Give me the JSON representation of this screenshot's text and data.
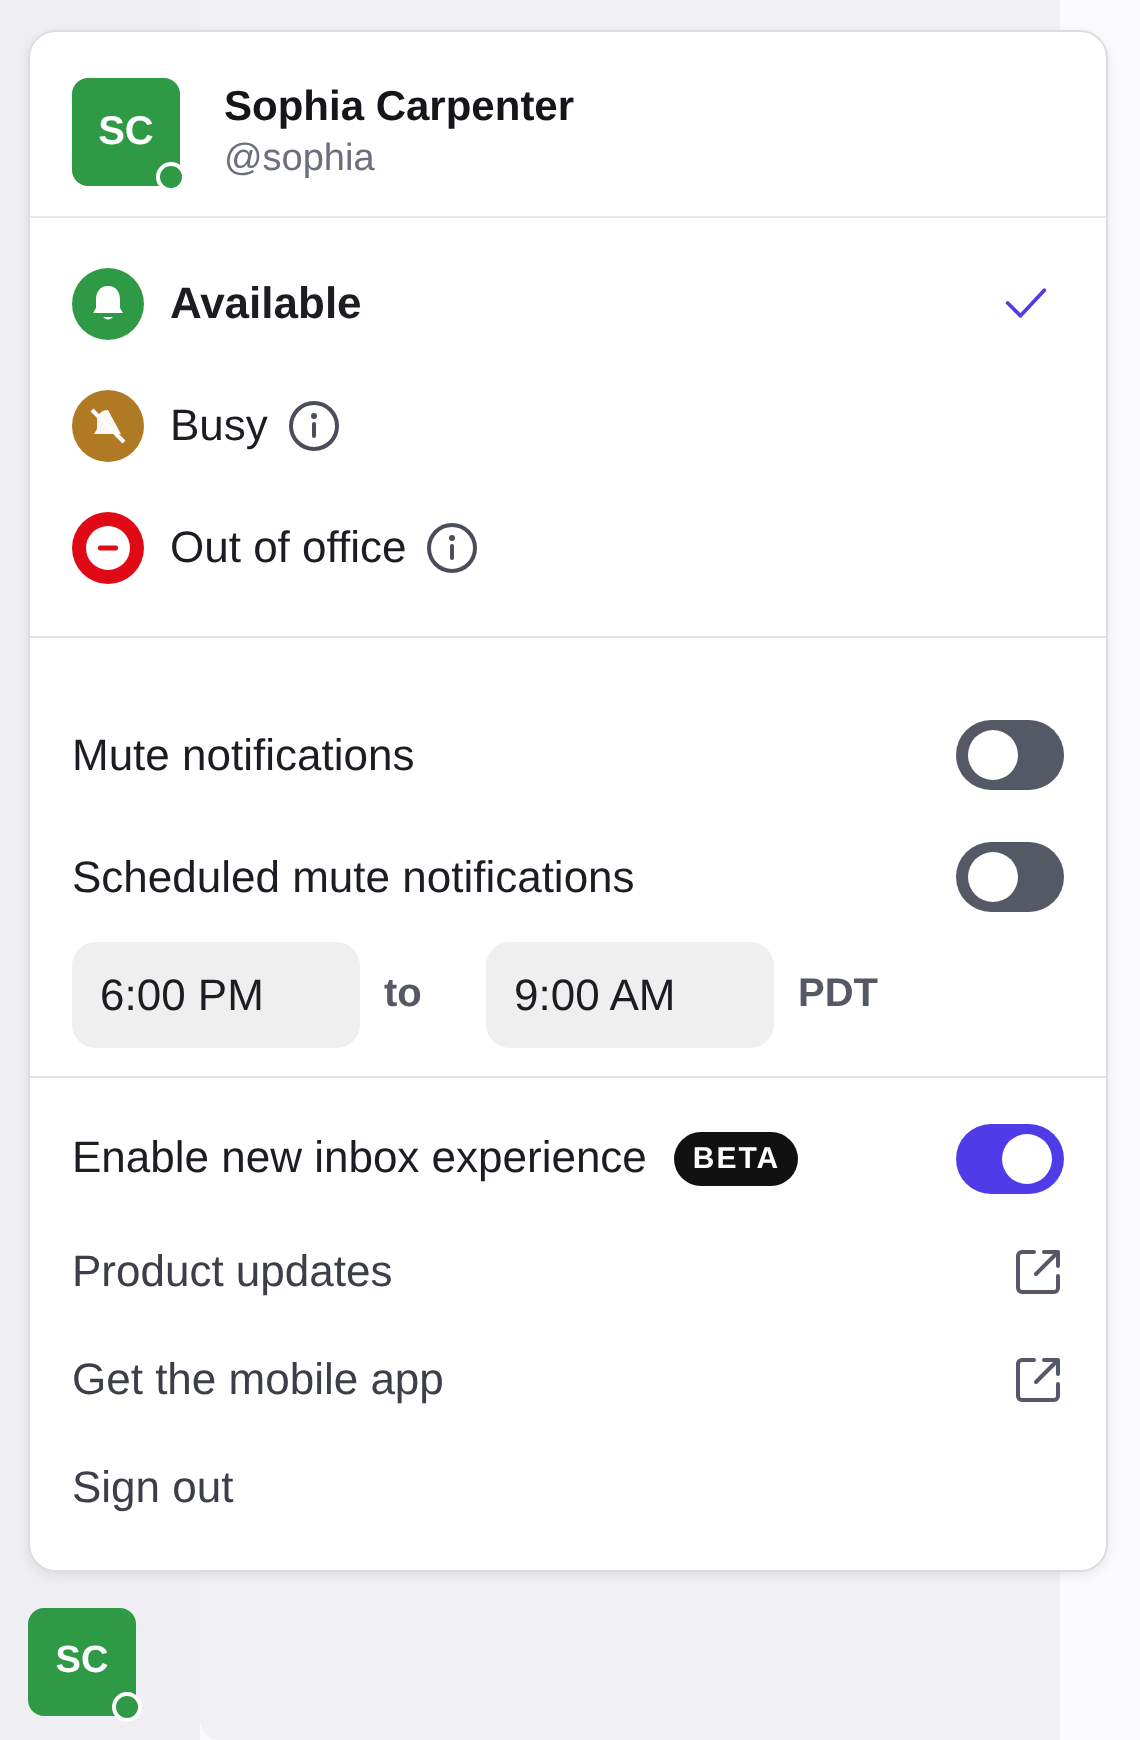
{
  "user": {
    "initials": "SC",
    "name": "Sophia Carpenter",
    "handle": "@sophia",
    "online": true
  },
  "statuses": [
    {
      "label": "Available",
      "kind": "available",
      "color": "#2f9a45",
      "selected": true,
      "info": false
    },
    {
      "label": "Busy",
      "kind": "busy",
      "color": "#b07a25",
      "selected": false,
      "info": true
    },
    {
      "label": "Out of office",
      "kind": "ooo",
      "color": "#e00a16",
      "selected": false,
      "info": true
    }
  ],
  "toggles": [
    {
      "label": "Mute notifications",
      "on": false
    },
    {
      "label": "Scheduled mute notifications",
      "on": false
    }
  ],
  "schedule": {
    "from": "6:00 PM",
    "separator": "to",
    "to": "9:00 AM",
    "timezone": "PDT"
  },
  "inbox": {
    "label": "Enable new inbox experience",
    "badge": "BETA",
    "on": true
  },
  "links": [
    {
      "label": "Product updates",
      "external": true
    },
    {
      "label": "Get the mobile app",
      "external": true
    },
    {
      "label": "Sign out",
      "external": false
    }
  ],
  "sidebar_avatar": {
    "initials": "SC",
    "online": true
  }
}
